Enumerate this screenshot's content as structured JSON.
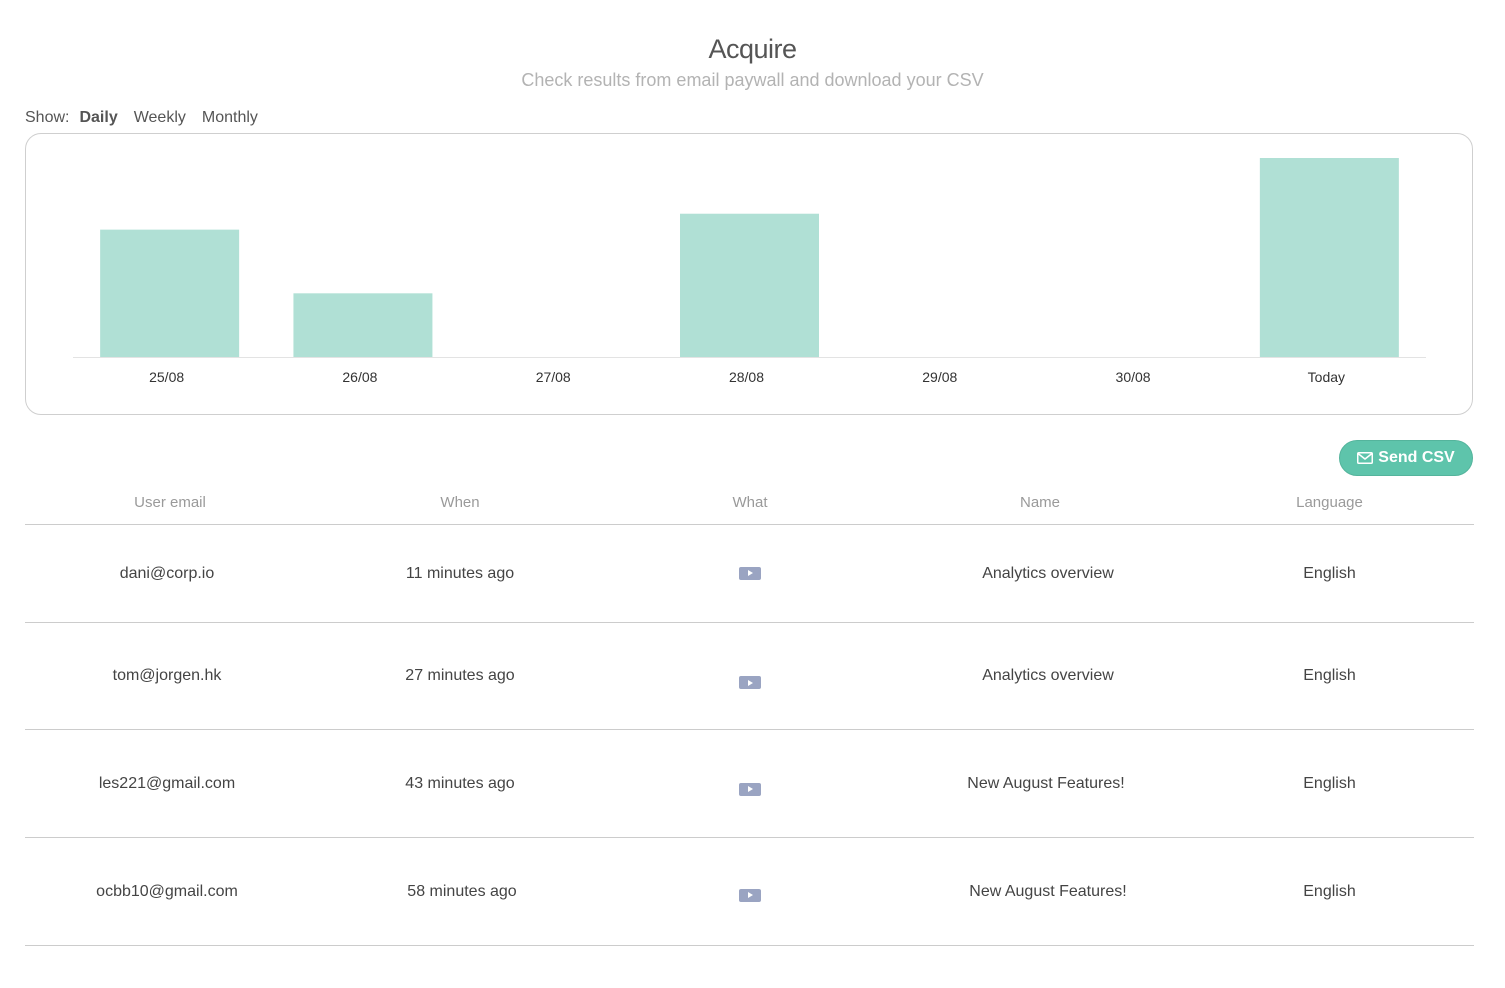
{
  "header": {
    "title": "Acquire",
    "subtitle": "Check results from email paywall and download your CSV"
  },
  "show": {
    "label": "Show:",
    "options": [
      "Daily",
      "Weekly",
      "Monthly"
    ],
    "selected": "Daily"
  },
  "colors": {
    "bar": "#b0e0d5",
    "accent": "#5ec4ab",
    "icon": "#9aa4c2"
  },
  "chart_data": {
    "type": "bar",
    "categories": [
      "25/08",
      "26/08",
      "27/08",
      "28/08",
      "29/08",
      "30/08",
      "Today"
    ],
    "values": [
      6.4,
      3.2,
      0,
      7.2,
      0,
      0,
      10
    ],
    "title": "",
    "xlabel": "",
    "ylabel": "",
    "ylim": [
      0,
      10
    ],
    "grid": false
  },
  "actions": {
    "send_csv_label": "Send CSV"
  },
  "table": {
    "columns": [
      "User email",
      "When",
      "What",
      "Name",
      "Language"
    ],
    "rows": [
      {
        "email": "dani@corp.io",
        "when": "11 minutes ago",
        "what": "video-icon",
        "name": "Analytics overview",
        "language": "English"
      },
      {
        "email": "tom@jorgen.hk",
        "when": "27 minutes ago",
        "what": "video-icon",
        "name": "Analytics overview",
        "language": "English"
      },
      {
        "email": "les221@gmail.com",
        "when": "43 minutes ago",
        "what": "video-icon",
        "name": "New August Features!",
        "language": "English"
      },
      {
        "email": "ocbb10@gmail.com",
        "when": "58  minutes ago",
        "what": "video-icon",
        "name": "New August Features!",
        "language": "English"
      }
    ]
  }
}
